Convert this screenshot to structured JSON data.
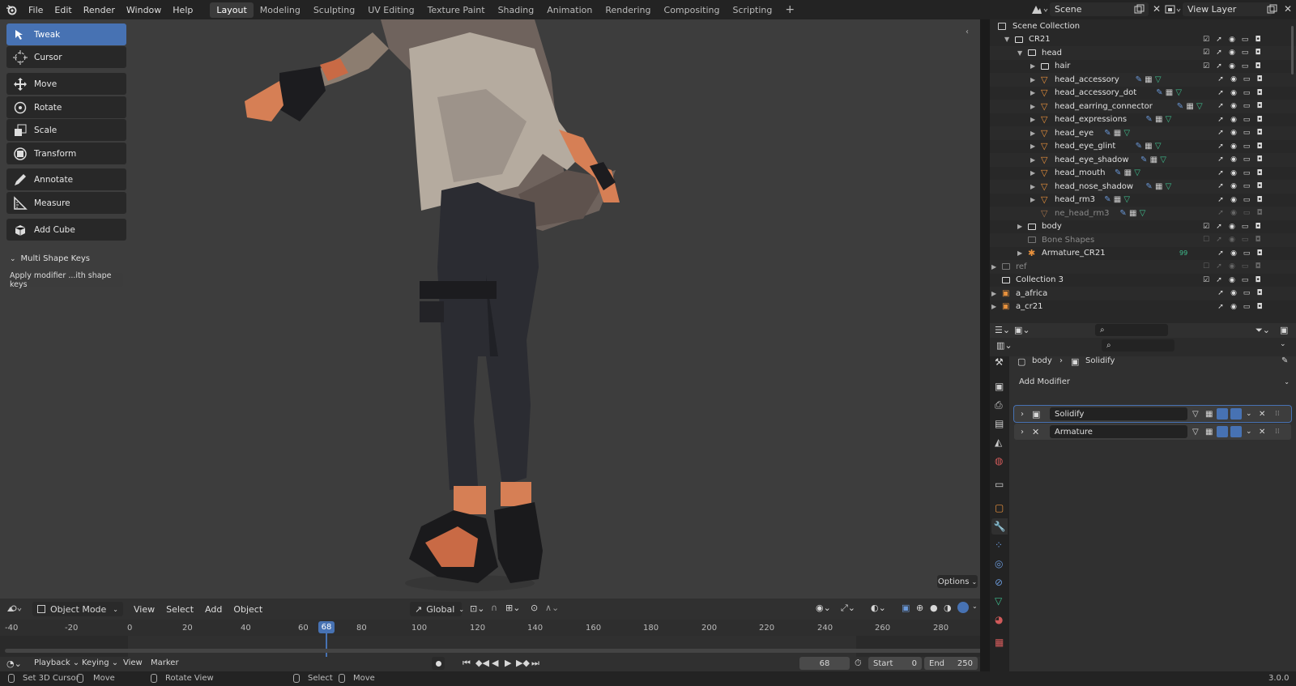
{
  "topbar": {
    "menus": [
      "File",
      "Edit",
      "Render",
      "Window",
      "Help"
    ],
    "workspaces": [
      "Layout",
      "Modeling",
      "Sculpting",
      "UV Editing",
      "Texture Paint",
      "Shading",
      "Animation",
      "Rendering",
      "Compositing",
      "Scripting"
    ],
    "active_workspace": "Layout",
    "add_tab": "+",
    "scene": "Scene",
    "view_layer": "View Layer"
  },
  "toolbar": {
    "tools": [
      "Tweak",
      "Cursor",
      "Move",
      "Rotate",
      "Scale",
      "Transform",
      "Annotate",
      "Measure",
      "Add Cube"
    ],
    "active": "Tweak",
    "panel_title": "Multi Shape Keys",
    "panel_button": "Apply modifier ...ith shape keys"
  },
  "viewport": {
    "options": "Options",
    "mode": "Object Mode",
    "menus": [
      "View",
      "Select",
      "Add",
      "Object"
    ],
    "orientation": "Global"
  },
  "timeline": {
    "ticks": [
      "-40",
      "-20",
      "0",
      "20",
      "40",
      "60",
      "80",
      "100",
      "120",
      "140",
      "160",
      "180",
      "200",
      "220",
      "240",
      "260",
      "280"
    ],
    "current_frame": "68",
    "menus": [
      "Playback",
      "Keying",
      "View",
      "Marker"
    ],
    "frame_field": "68",
    "start_label": "Start",
    "start": "0",
    "end_label": "End",
    "end": "250"
  },
  "statusbar": {
    "items": [
      "Set 3D Cursor",
      "Move",
      "Rotate View",
      "Select",
      "Move"
    ],
    "version": "3.0.0"
  },
  "outliner": {
    "root": "Scene Collection",
    "rows": [
      {
        "label": "CR21",
        "dim": false
      },
      {
        "label": "head",
        "dim": false
      },
      {
        "label": "hair",
        "dim": false
      },
      {
        "label": "head_accessory",
        "dim": false
      },
      {
        "label": "head_accessory_dot",
        "dim": false
      },
      {
        "label": "head_earring_connector",
        "dim": false
      },
      {
        "label": "head_expressions",
        "dim": false
      },
      {
        "label": "head_eye",
        "dim": false
      },
      {
        "label": "head_eye_glint",
        "dim": false
      },
      {
        "label": "head_eye_shadow",
        "dim": false
      },
      {
        "label": "head_mouth",
        "dim": false
      },
      {
        "label": "head_nose_shadow",
        "dim": false
      },
      {
        "label": "head_rm3",
        "dim": false
      },
      {
        "label": "ne_head_rm3",
        "dim": true
      },
      {
        "label": "body",
        "dim": false
      },
      {
        "label": "Bone Shapes",
        "dim": true
      },
      {
        "label": "Armature_CR21",
        "dim": false
      },
      {
        "label": "ref",
        "dim": true
      },
      {
        "label": "Collection 3",
        "dim": false
      },
      {
        "label": "a_africa",
        "dim": false
      },
      {
        "label": "a_cr21",
        "dim": false
      }
    ],
    "armature_badge": "99"
  },
  "properties": {
    "breadcrumb_object": "body",
    "breadcrumb_modifier": "Solidify",
    "add_modifier": "Add Modifier",
    "modifiers": [
      "Solidify",
      "Armature"
    ]
  },
  "colors": {
    "accent": "#4772b3",
    "mesh_orange": "#e8913c",
    "modifier_blue": "#6a98d8",
    "data_green": "#3fbf8f"
  }
}
